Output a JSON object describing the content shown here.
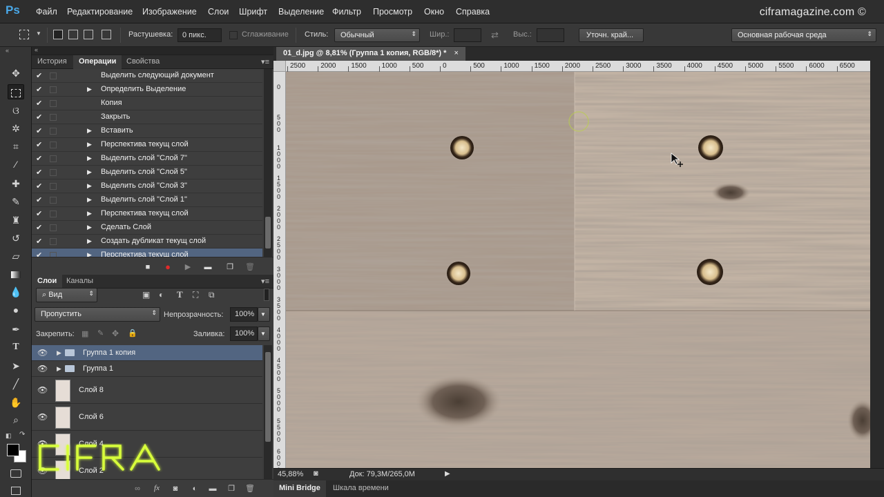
{
  "app": {
    "logo": "Ps",
    "watermark": "ciframagazine.com ©",
    "menu": [
      "Файл",
      "Редактирование",
      "Изображение",
      "Слои",
      "Шрифт",
      "Выделение",
      "Фильтр",
      "Просмотр",
      "Окно",
      "Справка"
    ]
  },
  "options": {
    "feather_label": "Растушевка:",
    "feather_value": "0 пикс.",
    "antialias_label": "Сглаживание",
    "style_label": "Стиль:",
    "style_value": "Обычный",
    "width_label": "Шир.:",
    "height_label": "Выс.:",
    "refine_button": "Уточн. край...",
    "workspace": "Основная рабочая среда"
  },
  "tools": [
    "move",
    "rect-marquee",
    "lasso",
    "magic-wand",
    "crop",
    "eyedropper",
    "healing",
    "brush",
    "stamp",
    "history-brush",
    "eraser",
    "gradient",
    "blur",
    "dodge",
    "pen",
    "type",
    "path-select",
    "line",
    "hand",
    "zoom"
  ],
  "actions_panel": {
    "tabs": [
      "История",
      "Операции",
      "Свойства"
    ],
    "active_tab": "Операции",
    "items": [
      {
        "label": "Выделить  следующий документ",
        "expandable": false
      },
      {
        "label": "Определить Выделение",
        "expandable": true
      },
      {
        "label": "Копия",
        "expandable": false
      },
      {
        "label": "Закрыть",
        "expandable": false
      },
      {
        "label": "Вставить",
        "expandable": true
      },
      {
        "label": "Перспектива текущ слой",
        "expandable": true
      },
      {
        "label": "Выделить слой \"Слой 7\"",
        "expandable": true
      },
      {
        "label": "Выделить слой \"Слой 5\"",
        "expandable": true
      },
      {
        "label": "Выделить слой \"Слой 3\"",
        "expandable": true
      },
      {
        "label": "Выделить слой \"Слой 1\"",
        "expandable": true
      },
      {
        "label": "Перспектива текущ слой",
        "expandable": true
      },
      {
        "label": "Сделать Слой",
        "expandable": true
      },
      {
        "label": "Создать дубликат текущ слой",
        "expandable": true
      },
      {
        "label": "Перспектива текущ слой",
        "expandable": true,
        "selected": true
      }
    ]
  },
  "layers_panel": {
    "tabs": [
      "Слои",
      "Каналы"
    ],
    "filter": "Вид",
    "blend_mode": "Пропустить",
    "opacity_label": "Непрозрачность:",
    "opacity_value": "100%",
    "lock_label": "Закрепить:",
    "fill_label": "Заливка:",
    "fill_value": "100%",
    "layers": [
      {
        "name": "Группа 1 копия",
        "type": "group",
        "selected": true
      },
      {
        "name": "Группа 1",
        "type": "group"
      },
      {
        "name": "Слой 8",
        "type": "layer"
      },
      {
        "name": "Слой 6",
        "type": "layer"
      },
      {
        "name": "Слой 4",
        "type": "layer"
      },
      {
        "name": "Слой 2",
        "type": "layer"
      }
    ]
  },
  "document": {
    "tab_title": "01_d.jpg @ 8,81% (Группа 1 копия, RGB/8*) *",
    "ruler_h": [
      "2500",
      "2000",
      "1500",
      "1000",
      "500",
      "0",
      "500",
      "1000",
      "1500",
      "2000",
      "2500",
      "3000",
      "3500",
      "4000",
      "4500",
      "5000",
      "5500",
      "6000",
      "6500"
    ],
    "ruler_v": [
      "0",
      "500",
      "1000",
      "1500",
      "2000",
      "2500",
      "3000",
      "3500",
      "4000",
      "4500",
      "5000",
      "5500",
      "6000"
    ]
  },
  "status": {
    "zoom": "45,88%",
    "doc_size": "Док: 79,3M/265,0M"
  },
  "bottom_tabs": [
    "Mini Bridge",
    "Шкала времени"
  ],
  "overlay_logo": "CIFRA"
}
